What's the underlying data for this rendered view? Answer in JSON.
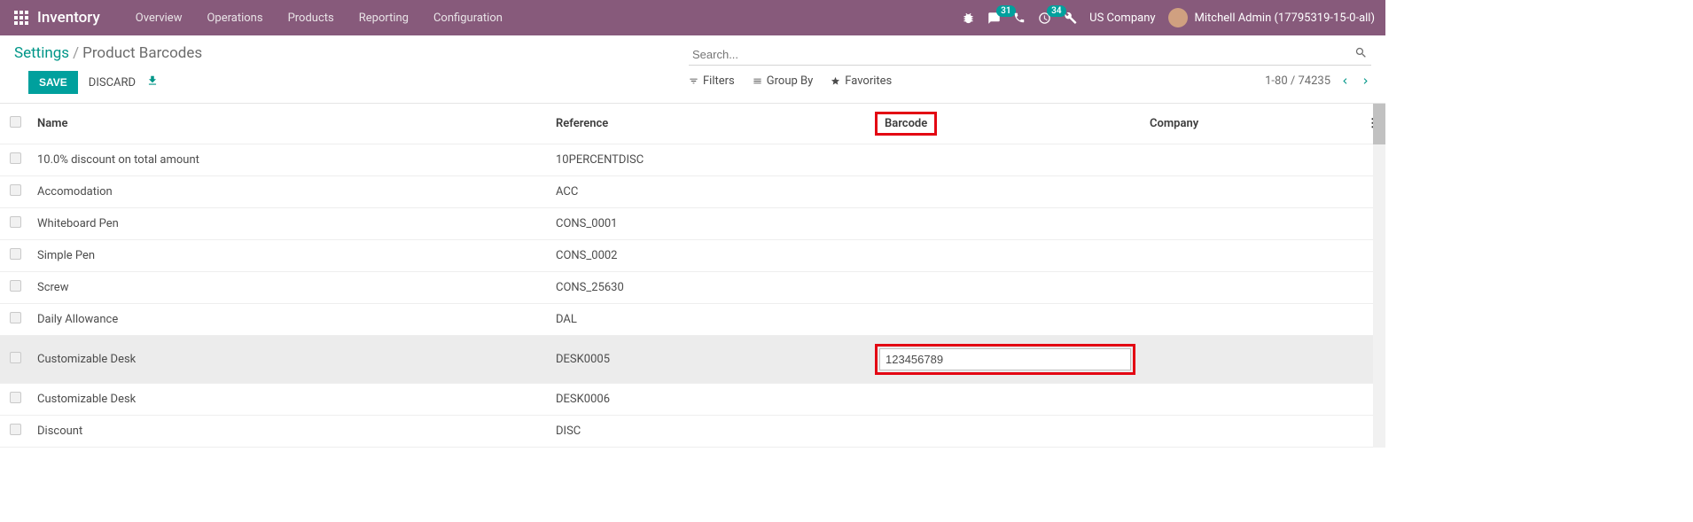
{
  "header": {
    "app": "Inventory",
    "menu": [
      "Overview",
      "Operations",
      "Products",
      "Reporting",
      "Configuration"
    ],
    "msg_badge": "31",
    "activity_badge": "34",
    "company": "US Company",
    "user": "Mitchell Admin (17795319-15-0-all)"
  },
  "breadcrumb": {
    "root": "Settings",
    "current": "Product Barcodes"
  },
  "actions": {
    "save": "SAVE",
    "discard": "DISCARD"
  },
  "search": {
    "placeholder": "Search...",
    "filters": "Filters",
    "groupby": "Group By",
    "favorites": "Favorites"
  },
  "pager": {
    "range": "1-80",
    "total": "74235"
  },
  "columns": {
    "name": "Name",
    "reference": "Reference",
    "barcode": "Barcode",
    "company": "Company"
  },
  "rows": [
    {
      "name": "10.0% discount on total amount",
      "ref": "10PERCENTDISC",
      "barcode": "",
      "company": ""
    },
    {
      "name": "Accomodation",
      "ref": "ACC",
      "barcode": "",
      "company": ""
    },
    {
      "name": "Whiteboard Pen",
      "ref": "CONS_0001",
      "barcode": "",
      "company": ""
    },
    {
      "name": "Simple Pen",
      "ref": "CONS_0002",
      "barcode": "",
      "company": ""
    },
    {
      "name": "Screw",
      "ref": "CONS_25630",
      "barcode": "",
      "company": ""
    },
    {
      "name": "Daily Allowance",
      "ref": "DAL",
      "barcode": "",
      "company": ""
    },
    {
      "name": "Customizable Desk",
      "ref": "DESK0005",
      "barcode": "123456789",
      "company": "",
      "editing": true
    },
    {
      "name": "Customizable Desk",
      "ref": "DESK0006",
      "barcode": "",
      "company": ""
    },
    {
      "name": "Discount",
      "ref": "DISC",
      "barcode": "",
      "company": ""
    }
  ]
}
